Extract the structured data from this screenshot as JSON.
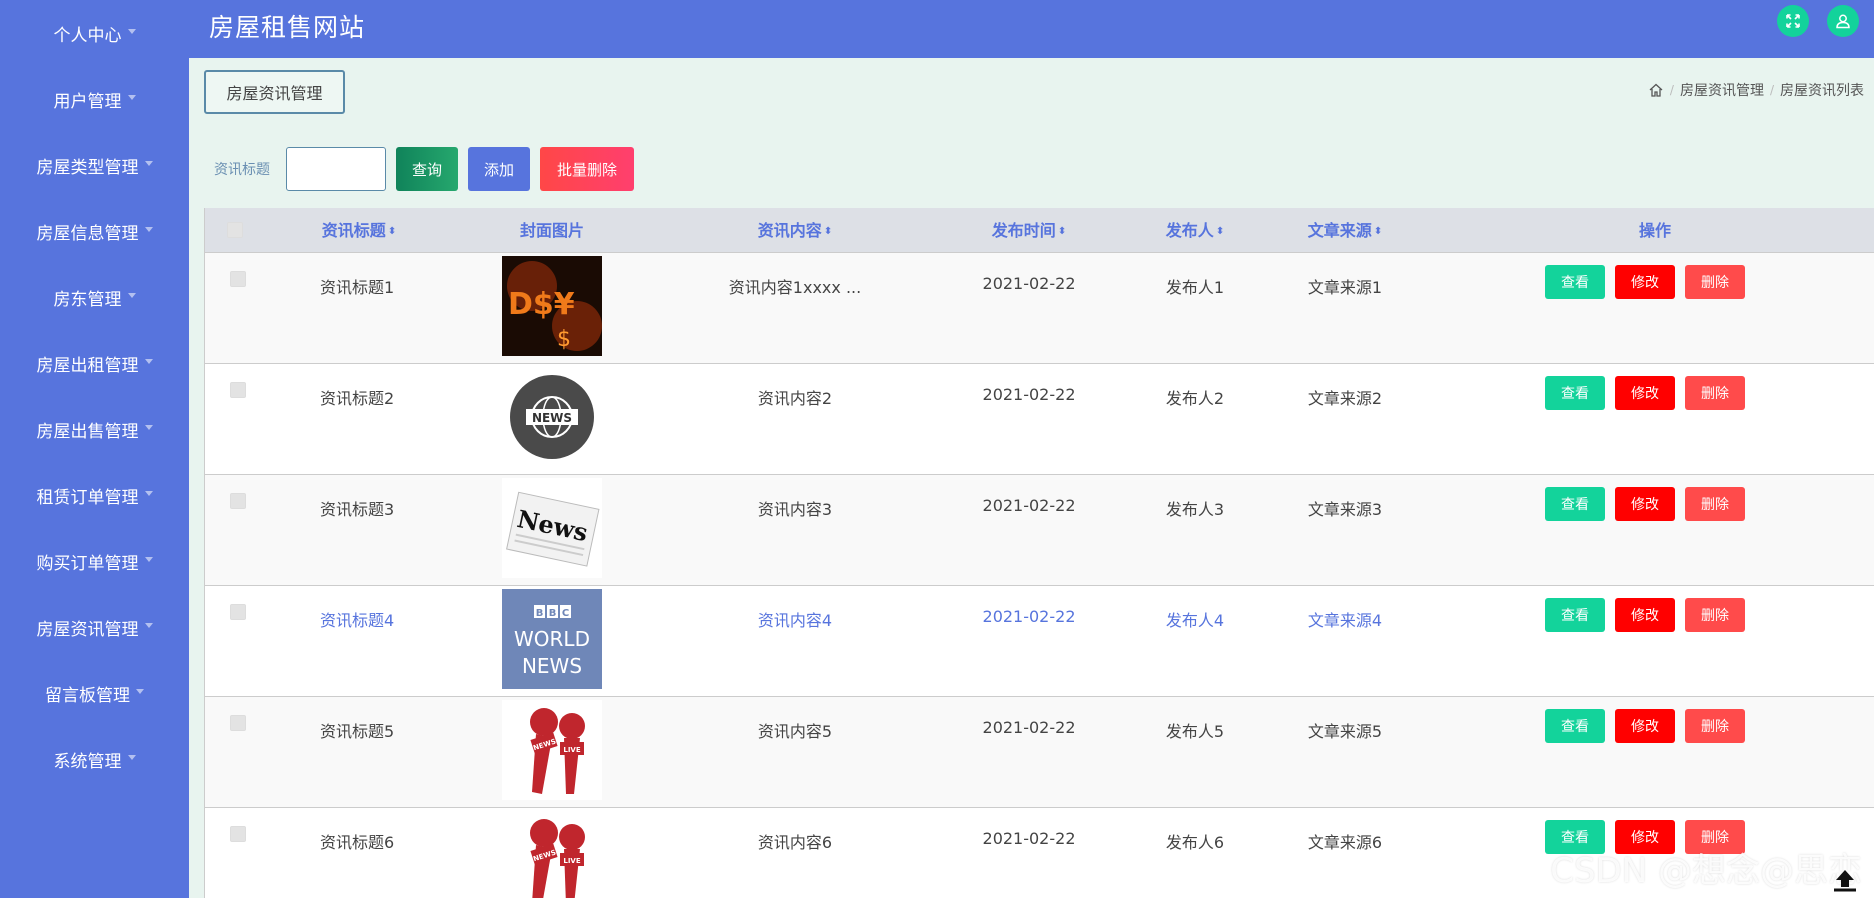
{
  "header": {
    "title": "房屋租售网站"
  },
  "sidebar": {
    "items": [
      {
        "label": "个人中心"
      },
      {
        "label": "用户管理"
      },
      {
        "label": "房屋类型管理"
      },
      {
        "label": "房屋信息管理"
      },
      {
        "label": "房东管理"
      },
      {
        "label": "房屋出租管理"
      },
      {
        "label": "房屋出售管理"
      },
      {
        "label": "租赁订单管理"
      },
      {
        "label": "购买订单管理"
      },
      {
        "label": "房屋资讯管理"
      },
      {
        "label": "留言板管理"
      },
      {
        "label": "系统管理"
      }
    ]
  },
  "page": {
    "tag": "房屋资讯管理",
    "breadcrumb": [
      "房屋资讯管理",
      "房屋资讯列表"
    ]
  },
  "search": {
    "label": "资讯标题",
    "value": "",
    "placeholder": "",
    "query_label": "查询",
    "add_label": "添加",
    "batch_delete_label": "批量删除"
  },
  "table": {
    "columns": {
      "title": "资讯标题",
      "cover": "封面图片",
      "content": "资讯内容",
      "time": "发布时间",
      "publisher": "发布人",
      "source": "文章来源",
      "ops": "操作"
    },
    "actions": {
      "view": "查看",
      "edit": "修改",
      "delete": "删除"
    },
    "rows": [
      {
        "title": "资讯标题1",
        "content": "资讯内容1xxxx ...",
        "time": "2021-02-22",
        "publisher": "发布人1",
        "source": "文章来源1"
      },
      {
        "title": "资讯标题2",
        "content": "资讯内容2",
        "time": "2021-02-22",
        "publisher": "发布人2",
        "source": "文章来源2"
      },
      {
        "title": "资讯标题3",
        "content": "资讯内容3",
        "time": "2021-02-22",
        "publisher": "发布人3",
        "source": "文章来源3"
      },
      {
        "title": "资讯标题4",
        "content": "资讯内容4",
        "time": "2021-02-22",
        "publisher": "发布人4",
        "source": "文章来源4"
      },
      {
        "title": "资讯标题5",
        "content": "资讯内容5",
        "time": "2021-02-22",
        "publisher": "发布人5",
        "source": "文章来源5"
      },
      {
        "title": "资讯标题6",
        "content": "资讯内容6",
        "time": "2021-02-22",
        "publisher": "发布人6",
        "source": "文章来源6"
      }
    ]
  },
  "thumbs": {
    "dollar_text": "D$¥",
    "news_badge": "NEWS",
    "newspaper_text": "News",
    "bbc_letters": [
      "B",
      "B",
      "C"
    ],
    "bbc_line1": "WORLD",
    "bbc_line2": "NEWS",
    "live_text": "LIVE",
    "mic_text": "NEWS"
  },
  "watermark": "CSDN @想念@思恋",
  "colors": {
    "primary": "#5774dd",
    "view": "#13d39b",
    "edit": "#ff0000",
    "delete": "#ff4b4b",
    "query": "#10835a",
    "batch": "#ff4747"
  },
  "icons": {
    "fullscreen": "fullscreen-icon",
    "user": "user-icon",
    "home": "home-icon",
    "back_to_top": "back-to-top-icon"
  }
}
